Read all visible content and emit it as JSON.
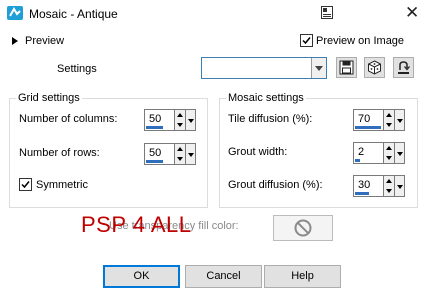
{
  "window": {
    "title": "Mosaic - Antique",
    "app_icon": "psp-app-icon",
    "system_icon": "window-menu-icon",
    "close_glyph": "✕"
  },
  "preview": {
    "label": "Preview",
    "preview_on_image_label": "Preview on Image",
    "preview_on_image_checked": true
  },
  "settings": {
    "label": "Settings",
    "value": "",
    "tool_icons": [
      "save-preset-icon",
      "randomize-icon",
      "reset-icon"
    ]
  },
  "grid_settings": {
    "title": "Grid settings",
    "columns": {
      "label": "Number of columns:",
      "value": "50"
    },
    "rows": {
      "label": "Number of rows:",
      "value": "50"
    },
    "symmetric": {
      "label": "Symmetric",
      "checked": true
    }
  },
  "mosaic_settings": {
    "title": "Mosaic settings",
    "tile_diffusion": {
      "label": "Tile diffusion (%):",
      "value": "70"
    },
    "grout_width": {
      "label": "Grout width:",
      "value": "2"
    },
    "grout_diffusion": {
      "label": "Grout diffusion (%):",
      "value": "30"
    }
  },
  "transparency": {
    "label": "Use transparency fill color:",
    "icon": "no-symbol-icon"
  },
  "watermark": {
    "text": "PSP 4 ALL",
    "color": "#c00000"
  },
  "buttons": {
    "ok": "OK",
    "cancel": "Cancel",
    "help": "Help"
  }
}
